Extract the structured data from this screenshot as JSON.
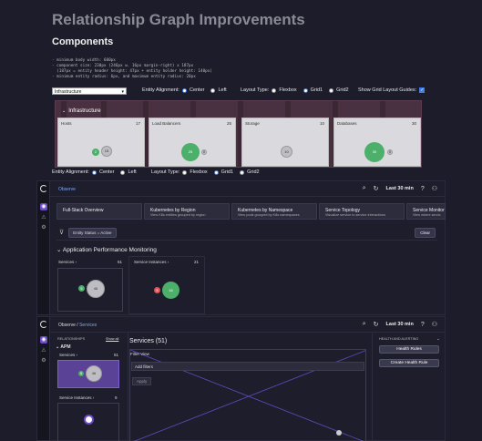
{
  "page": {
    "title": "Relationship Graph Improvements",
    "subtitle": "Components",
    "spec_lines": [
      "- minimum body width: 600px",
      "- component size: 230px (246px w. 16px margin-right) x 187px",
      "  (187px = entity header height: 47px + entity holder height: 140px)",
      "- minimum entity radius: 6px, and maximum entity radius: 20px"
    ],
    "select_value": "Infrastructure"
  },
  "controls_top": {
    "alignment_label": "Entity Alignment:",
    "center": "Center",
    "left": "Left",
    "layout_label": "Layout Type:",
    "flexbox": "Flexbox",
    "grid1": "Grid1",
    "grid2": "Grid2",
    "guides_label": "Show Grid Layout Guides:"
  },
  "infra": {
    "title": "Infrastructure",
    "cards": [
      {
        "label": "Hosts",
        "count": "17",
        "green": "2",
        "grey": "15"
      },
      {
        "label": "Load Balancers",
        "count": "25",
        "green": "25",
        "grey": "0"
      },
      {
        "label": "Storage",
        "count": "10",
        "green": "",
        "grey": "10"
      },
      {
        "label": "Databases",
        "count": "30",
        "green": "30",
        "grey": "0"
      }
    ]
  },
  "controls_bottom": {
    "alignment_label": "Entity Alignment:",
    "center": "Center",
    "left": "Left",
    "layout_label": "Layout Type:",
    "flexbox": "Flexbox",
    "grid1": "Grid1",
    "grid2": "Grid2"
  },
  "app1": {
    "breadcrumb": "Observe",
    "time": "Last 30 min",
    "tiles": [
      {
        "title": "Full-Stack Overview",
        "sub": ""
      },
      {
        "title": "Kubernetes by Region",
        "sub": "View K8s entities grouped by region"
      },
      {
        "title": "Kubernetes by Namespace",
        "sub": "View pods grouped by K8s namespaces"
      },
      {
        "title": "Service Topology",
        "sub": "Visualize service to service interactions"
      },
      {
        "title": "Service Monitor",
        "sub": "View where servic"
      }
    ],
    "filter_chip": "Entity Status = Active",
    "clear": "Clear",
    "section": "Application Performance Monitoring",
    "services": {
      "label": "Services",
      "count": "51",
      "green": "5",
      "grey": "46"
    },
    "instances": {
      "label": "Service Instances",
      "count": "21",
      "red": "5",
      "green": "16"
    }
  },
  "app2": {
    "breadcrumb_1": "Observe",
    "breadcrumb_sep": "/",
    "breadcrumb_2": "Services",
    "time": "Last 30 min",
    "rel_label": "RELATIONSHIPS",
    "show_all": "Show all",
    "apm": "APM",
    "services": {
      "label": "Services",
      "count": "51",
      "green": "5",
      "grey": "46"
    },
    "instances": {
      "label": "Service Instances",
      "count": "9"
    },
    "main_title": "Services (51)",
    "filter_view": "Filter View",
    "add_filters": "Add filters",
    "apply": "Apply",
    "health_title": "HEALTH AND ALERTING",
    "health_rules": "Health Rules",
    "create_rule": "Create Health Rule"
  },
  "colors": {
    "accent": "#6b4bc8",
    "link": "#7fa9f5",
    "green": "#4caf6a",
    "red": "#e0555a"
  }
}
